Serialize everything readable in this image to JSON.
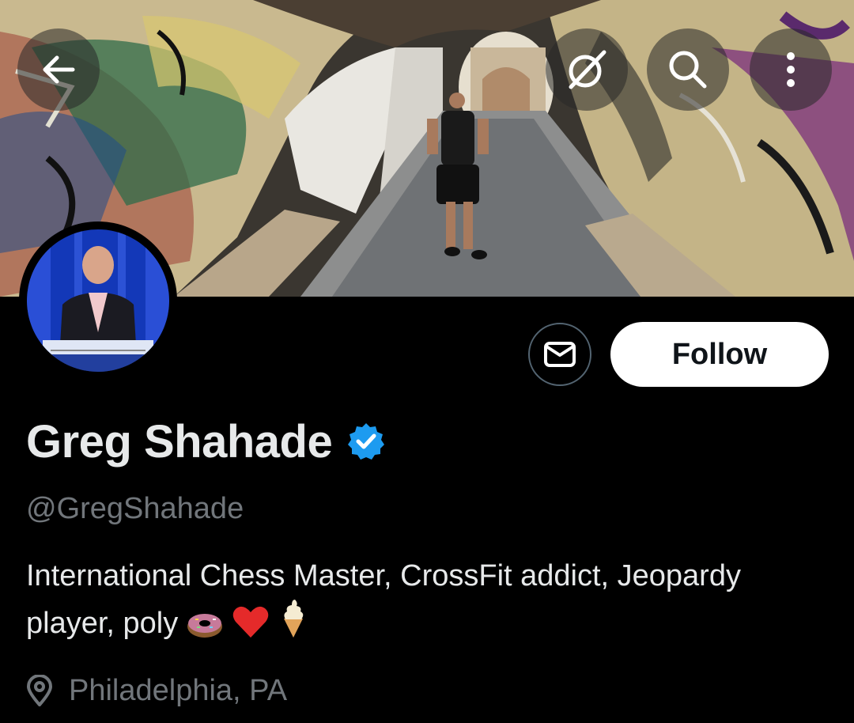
{
  "header": {
    "back_label": "Back",
    "grok_label": "Grok",
    "search_label": "Search",
    "more_label": "More options"
  },
  "profile": {
    "name": "Greg Shahade",
    "verified": true,
    "handle": "@GregShahade",
    "bio_text": "International Chess Master, CrossFit addict, Jeopardy player, poly",
    "bio_emojis": [
      "doughnut",
      "red-heart",
      "soft-ice-cream"
    ],
    "location": "Philadelphia, PA"
  },
  "actions": {
    "follow_label": "Follow",
    "message_label": "Message"
  },
  "colors": {
    "background": "#000000",
    "text_primary": "#e7e9ea",
    "text_secondary": "#71767b",
    "verified_blue": "#1d9bf0",
    "button_border": "#536471"
  }
}
